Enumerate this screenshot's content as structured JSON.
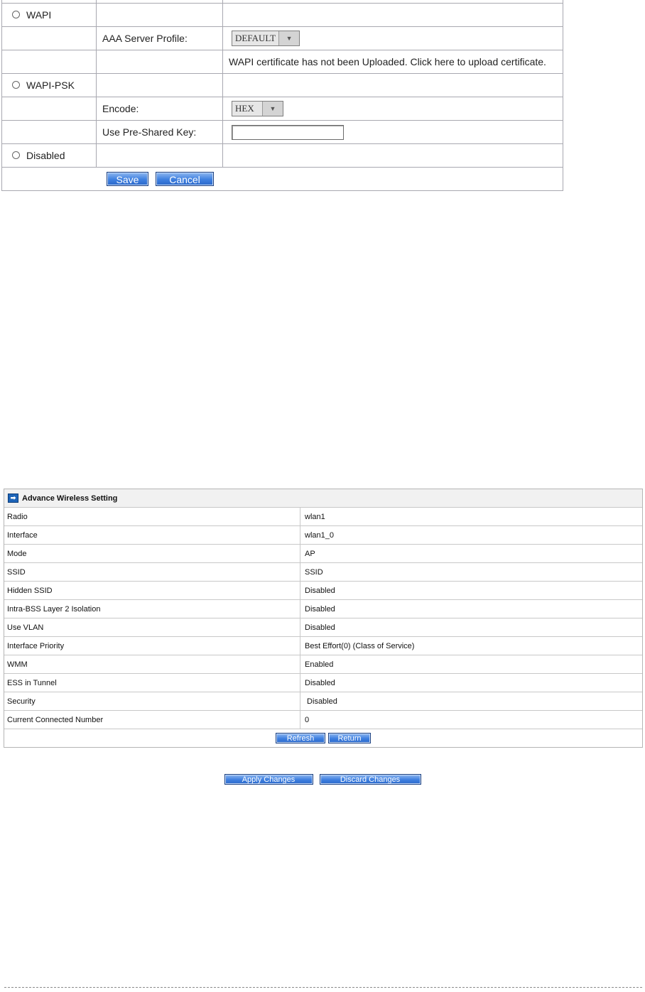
{
  "security_options": {
    "wapi": {
      "radio_label": "WAPI",
      "aaa_profile_label": "AAA Server Profile:",
      "aaa_profile_value": "DEFAULT",
      "certificate_message": "WAPI certificate has not been Uploaded. Click here to upload certificate."
    },
    "wapi_psk": {
      "radio_label": "WAPI-PSK",
      "encode_label": "Encode:",
      "encode_value": "HEX",
      "psk_label": "Use Pre-Shared Key:",
      "psk_value": ""
    },
    "disabled": {
      "radio_label": "Disabled"
    },
    "save_label": "Save",
    "cancel_label": "Cancel"
  },
  "advance_wireless": {
    "title": "Advance Wireless Setting",
    "rows": [
      {
        "label": "Radio",
        "value": "wlan1"
      },
      {
        "label": "Interface",
        "value": "wlan1_0"
      },
      {
        "label": "Mode",
        "value": "AP"
      },
      {
        "label": "SSID",
        "value": "SSID"
      },
      {
        "label": "Hidden SSID",
        "value": "Disabled"
      },
      {
        "label": "Intra-BSS Layer 2 Isolation",
        "value": "Disabled"
      },
      {
        "label": "Use VLAN",
        "value": "Disabled"
      },
      {
        "label": "Interface Priority",
        "value": "Best Effort(0)  (Class of Service)"
      },
      {
        "label": "WMM",
        "value": "Enabled"
      },
      {
        "label": "ESS in Tunnel",
        "value": "Disabled"
      },
      {
        "label": "Security",
        "value": " Disabled"
      },
      {
        "label": "Current Connected Number",
        "value": "0"
      }
    ],
    "refresh_label": "Refresh",
    "return_label": "Return"
  },
  "footer_buttons": {
    "apply_label": "Apply Changes",
    "discard_label": "Discard Changes"
  },
  "colors": {
    "button_blue": "#3d7fe0",
    "border_gray": "#a8a8b0"
  }
}
